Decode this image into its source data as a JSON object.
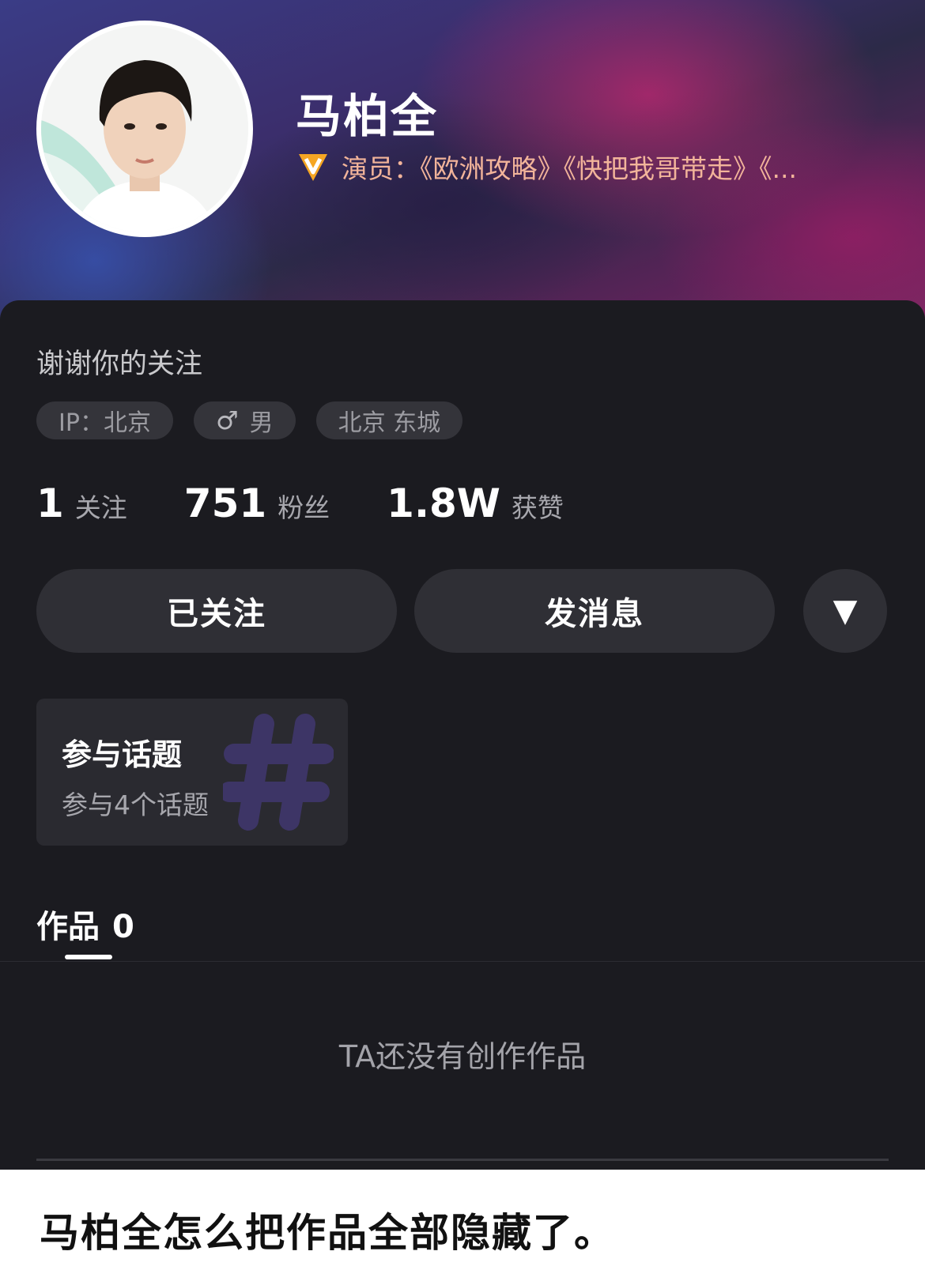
{
  "profile": {
    "name": "马柏全",
    "verification": "演员：《欧洲攻略》《快把我哥带走》《...",
    "bio": "谢谢你的关注",
    "tags": {
      "ip": "IP：北京",
      "gender_symbol": "♂",
      "gender": "男",
      "location": "北京 东城"
    },
    "stats": {
      "following_count": "1",
      "following_label": "关注",
      "followers_count": "751",
      "followers_label": "粉丝",
      "likes_count": "1.8W",
      "likes_label": "获赞"
    }
  },
  "actions": {
    "follow_label": "已关注",
    "message_label": "发消息",
    "more_icon": "▼"
  },
  "topic_card": {
    "title": "参与话题",
    "subtitle": "参与4个话题",
    "icon": "hash-icon"
  },
  "tabs": {
    "works_label": "作品",
    "works_count": "0"
  },
  "empty_state": "TA还没有创作作品",
  "caption": "马柏全怎么把作品全部隐藏了。",
  "colors": {
    "sheet_bg": "#1b1b20",
    "button_bg": "#2f2f35",
    "verify_text": "#f2b49a",
    "badge_orange": "#f5a623"
  }
}
